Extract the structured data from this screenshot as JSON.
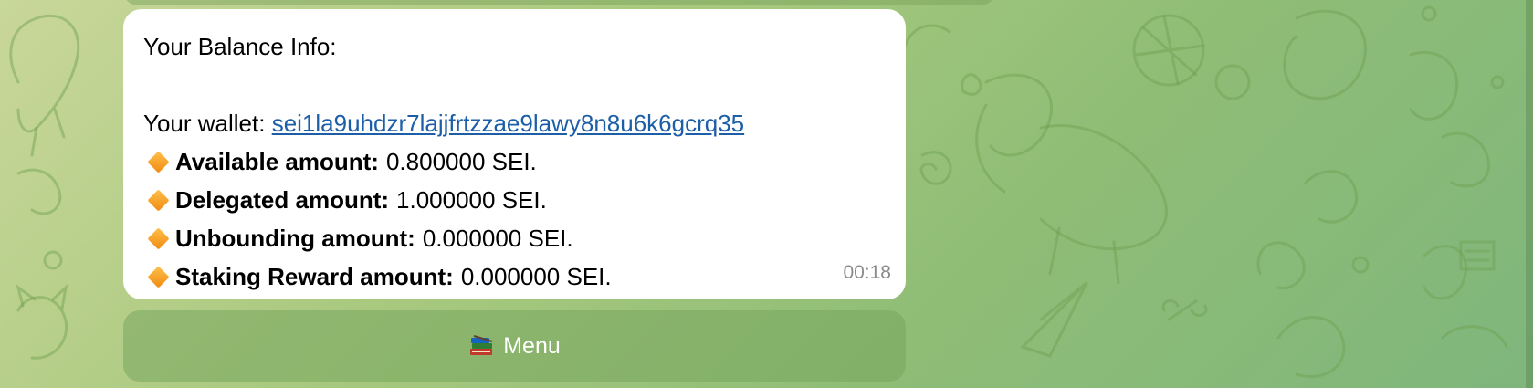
{
  "message": {
    "title": "Your Balance Info:",
    "wallet_label": "Your wallet:",
    "wallet_address": "sei1la9uhdzr7lajjfrtzzae9lawy8n8u6k6gcrq35",
    "items": [
      {
        "label": "Available amount:",
        "value": "0.800000 SEI."
      },
      {
        "label": "Delegated amount:",
        "value": "1.000000 SEI."
      },
      {
        "label": "Unbounding amount:",
        "value": "0.000000 SEI."
      },
      {
        "label": "Staking Reward amount:",
        "value": "0.000000 SEI."
      }
    ],
    "time": "00:18"
  },
  "keyboard": {
    "menu_label": "Menu",
    "menu_icon": "books-icon"
  },
  "colors": {
    "link": "#1c5ea8",
    "bullet": "#f5a623",
    "bubble": "#ffffff"
  }
}
